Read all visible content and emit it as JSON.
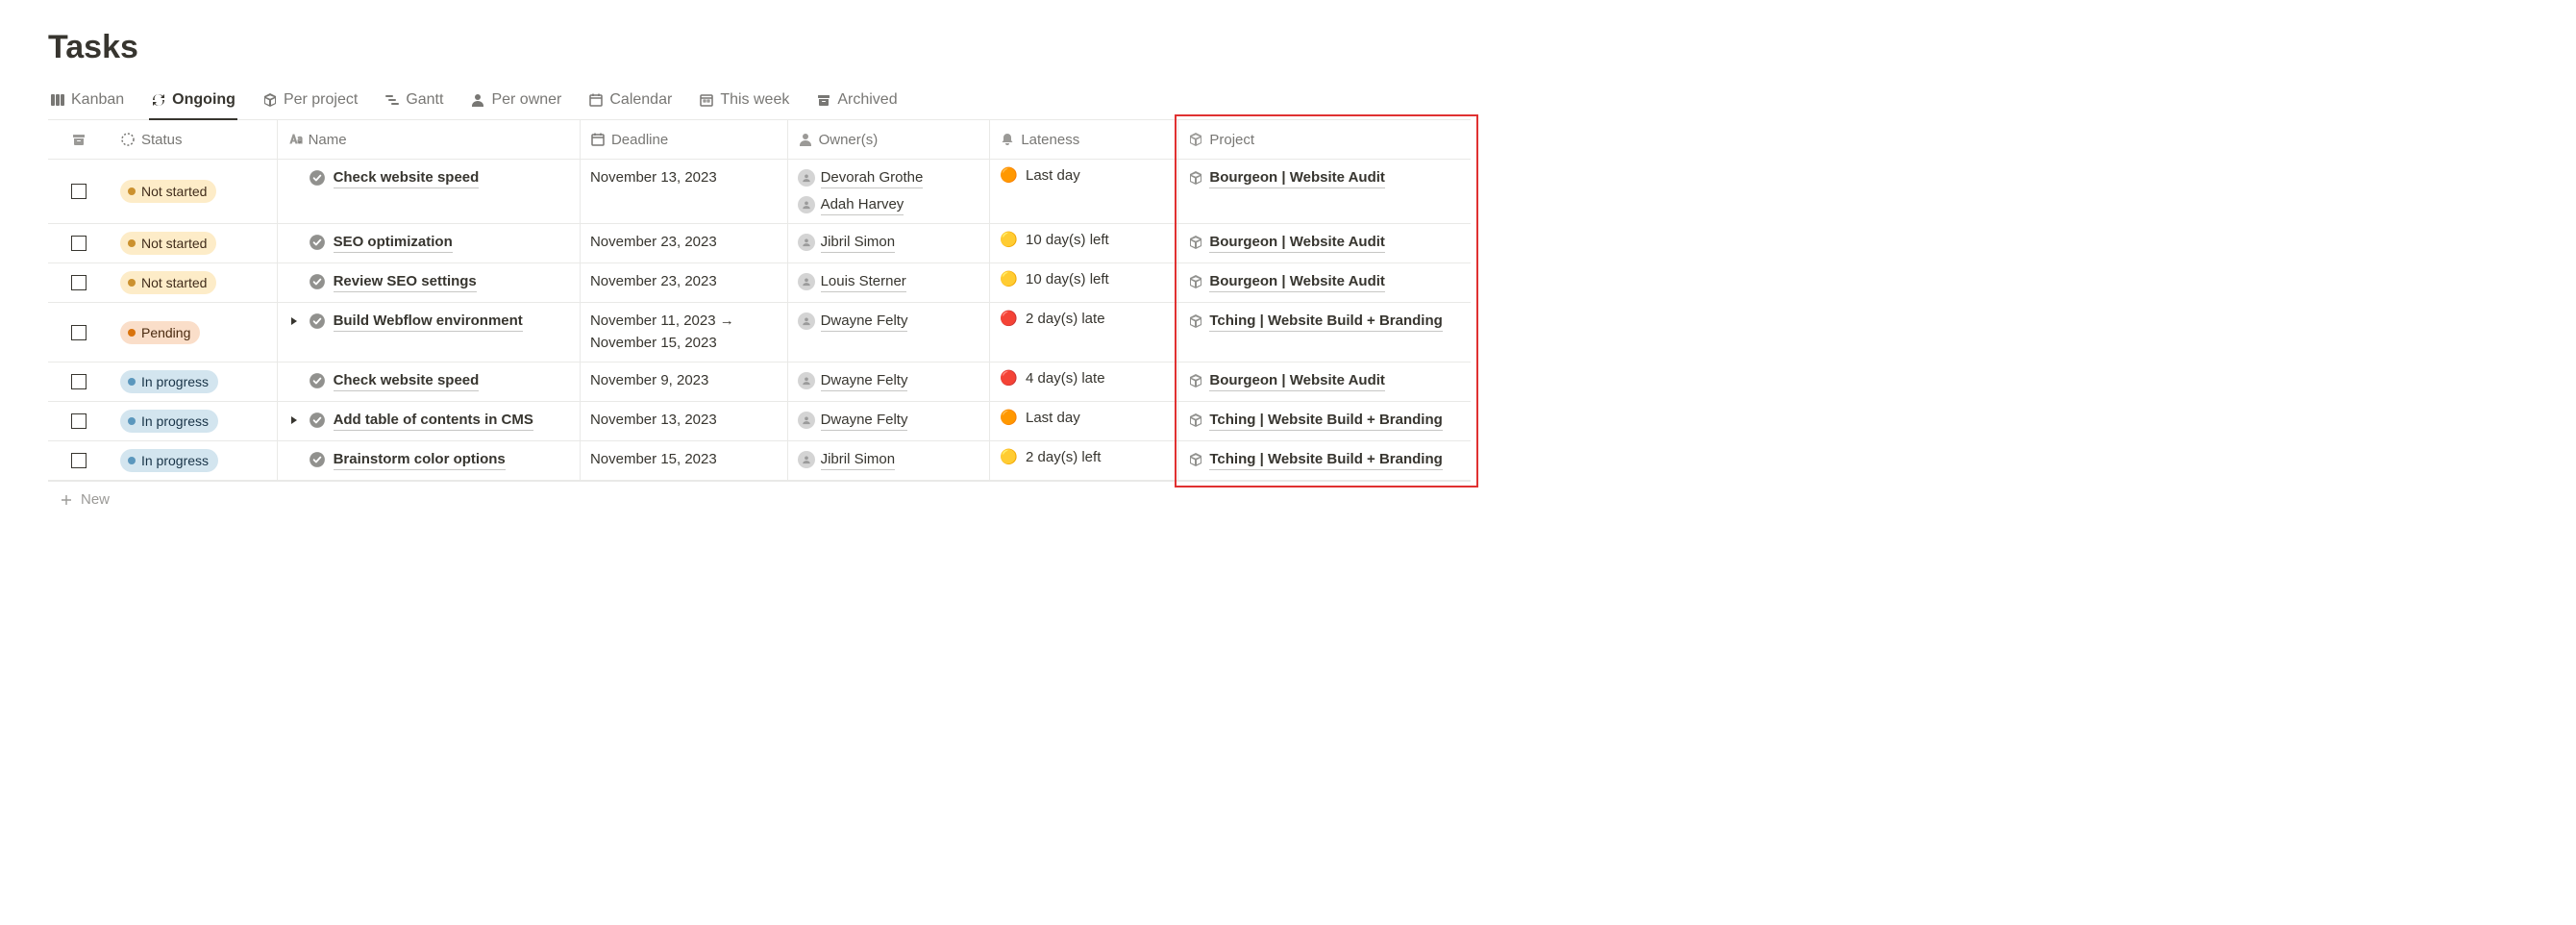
{
  "page_title": "Tasks",
  "tabs": [
    {
      "label": "Kanban",
      "icon": "board",
      "active": false
    },
    {
      "label": "Ongoing",
      "icon": "refresh",
      "active": true
    },
    {
      "label": "Per project",
      "icon": "cube",
      "active": false
    },
    {
      "label": "Gantt",
      "icon": "gantt",
      "active": false
    },
    {
      "label": "Per owner",
      "icon": "person",
      "active": false
    },
    {
      "label": "Calendar",
      "icon": "calendar",
      "active": false
    },
    {
      "label": "This week",
      "icon": "date",
      "active": false
    },
    {
      "label": "Archived",
      "icon": "archive",
      "active": false
    }
  ],
  "columns": {
    "checkbox_icon": "archive-box",
    "status": "Status",
    "name": "Name",
    "deadline": "Deadline",
    "owners": "Owner(s)",
    "lateness": "Lateness",
    "project": "Project"
  },
  "rows": [
    {
      "status": {
        "label": "Not started",
        "kind": "notstarted"
      },
      "expandable": false,
      "name": "Check website speed",
      "deadline": "November 13, 2023",
      "owners": [
        "Devorah Grothe",
        "Adah Harvey"
      ],
      "lateness": {
        "dot": "🟠",
        "text": "Last day"
      },
      "project": "Bourgeon | Website Audit"
    },
    {
      "status": {
        "label": "Not started",
        "kind": "notstarted"
      },
      "expandable": false,
      "name": "SEO optimization",
      "deadline": "November 23, 2023",
      "owners": [
        "Jibril Simon"
      ],
      "lateness": {
        "dot": "🟡",
        "text": "10 day(s) left"
      },
      "project": "Bourgeon | Website Audit"
    },
    {
      "status": {
        "label": "Not started",
        "kind": "notstarted"
      },
      "expandable": false,
      "name": "Review SEO settings",
      "deadline": "November 23, 2023",
      "owners": [
        "Louis Sterner"
      ],
      "lateness": {
        "dot": "🟡",
        "text": "10 day(s) left"
      },
      "project": "Bourgeon | Website Audit"
    },
    {
      "status": {
        "label": "Pending",
        "kind": "pending"
      },
      "expandable": true,
      "name": "Build Webflow environment",
      "deadline": "November 11, 2023 → November 15, 2023",
      "owners": [
        "Dwayne Felty"
      ],
      "lateness": {
        "dot": "🔴",
        "text": "2 day(s) late"
      },
      "project": "Tching | Website Build + Branding"
    },
    {
      "status": {
        "label": "In progress",
        "kind": "inprogress"
      },
      "expandable": false,
      "name": "Check website speed",
      "deadline": "November 9, 2023",
      "owners": [
        "Dwayne Felty"
      ],
      "lateness": {
        "dot": "🔴",
        "text": "4 day(s) late"
      },
      "project": "Bourgeon | Website Audit"
    },
    {
      "status": {
        "label": "In progress",
        "kind": "inprogress"
      },
      "expandable": true,
      "name": "Add table of contents in CMS",
      "deadline": "November 13, 2023",
      "owners": [
        "Dwayne Felty"
      ],
      "lateness": {
        "dot": "🟠",
        "text": "Last day"
      },
      "project": "Tching | Website Build + Branding"
    },
    {
      "status": {
        "label": "In progress",
        "kind": "inprogress"
      },
      "expandable": false,
      "name": "Brainstorm color options",
      "deadline": "November 15, 2023",
      "owners": [
        "Jibril Simon"
      ],
      "lateness": {
        "dot": "🟡",
        "text": "2 day(s) left"
      },
      "project": "Tching | Website Build + Branding"
    }
  ],
  "new_row_label": "New"
}
